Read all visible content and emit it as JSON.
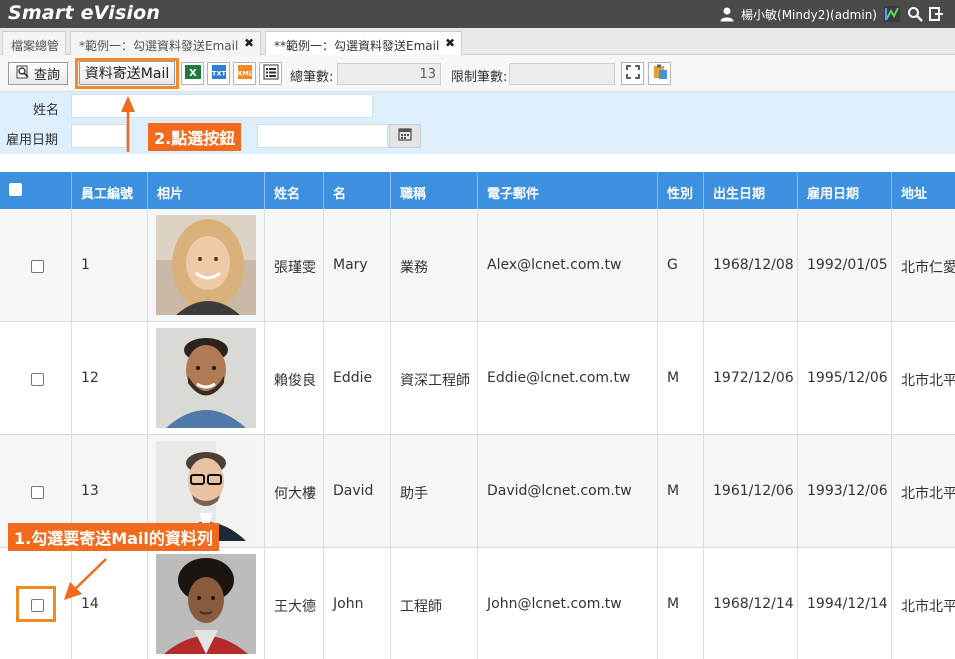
{
  "app": {
    "title": "Smart eVision",
    "user": "楊小敏(Mindy2)(admin)"
  },
  "tabs": [
    {
      "label": "檔案總管",
      "closable": false
    },
    {
      "label": "*範例一：勾選資料發送Email",
      "closable": true
    },
    {
      "label": "**範例一：勾選資料發送Email",
      "closable": true,
      "active": true
    }
  ],
  "toolbar": {
    "query_label": "查詢",
    "send_mail_label": "資料寄送Mail",
    "total_label": "總筆數:",
    "total_value": "13",
    "limit_label": "限制筆數:",
    "limit_value": ""
  },
  "query": {
    "name_label": "姓名",
    "name_value": "",
    "hire_label": "雇用日期",
    "hire_from": "",
    "hire_to": ""
  },
  "annotations": {
    "step1": "1.勾選要寄送Mail的資料列",
    "step2": "2.點選按鈕"
  },
  "colors": {
    "header_blue": "#3d8fe0",
    "annotation_orange": "#f26a1b",
    "query_panel": "#ddeefc"
  },
  "grid": {
    "columns": [
      "員工編號",
      "相片",
      "姓名",
      "名",
      "職稱",
      "電子郵件",
      "性別",
      "出生日期",
      "雇用日期",
      "地址"
    ],
    "rows": [
      {
        "id": "1",
        "photo": "woman-blonde-portrait",
        "name": "張瑾雯",
        "first": "Mary",
        "title": "業務",
        "email": "Alex@lcnet.com.tw",
        "gender": "G",
        "birth": "1968/12/08",
        "hire": "1992/01/05",
        "address": "北市仁愛"
      },
      {
        "id": "12",
        "photo": "man-bearded-portrait",
        "name": "賴俊良",
        "first": "Eddie",
        "title": "資深工程師",
        "email": "Eddie@lcnet.com.tw",
        "gender": "M",
        "birth": "1972/12/06",
        "hire": "1995/12/06",
        "address": "北市北平"
      },
      {
        "id": "13",
        "photo": "man-glasses-suit-portrait",
        "name": "何大樓",
        "first": "David",
        "title": "助手",
        "email": "David@lcnet.com.tw",
        "gender": "M",
        "birth": "1961/12/06",
        "hire": "1993/12/06",
        "address": "北市北平"
      },
      {
        "id": "14",
        "photo": "man-curly-hair-portrait",
        "name": "王大德",
        "first": "John",
        "title": "工程師",
        "email": "John@lcnet.com.tw",
        "gender": "M",
        "birth": "1968/12/14",
        "hire": "1994/12/14",
        "address": "北市北平"
      }
    ]
  }
}
